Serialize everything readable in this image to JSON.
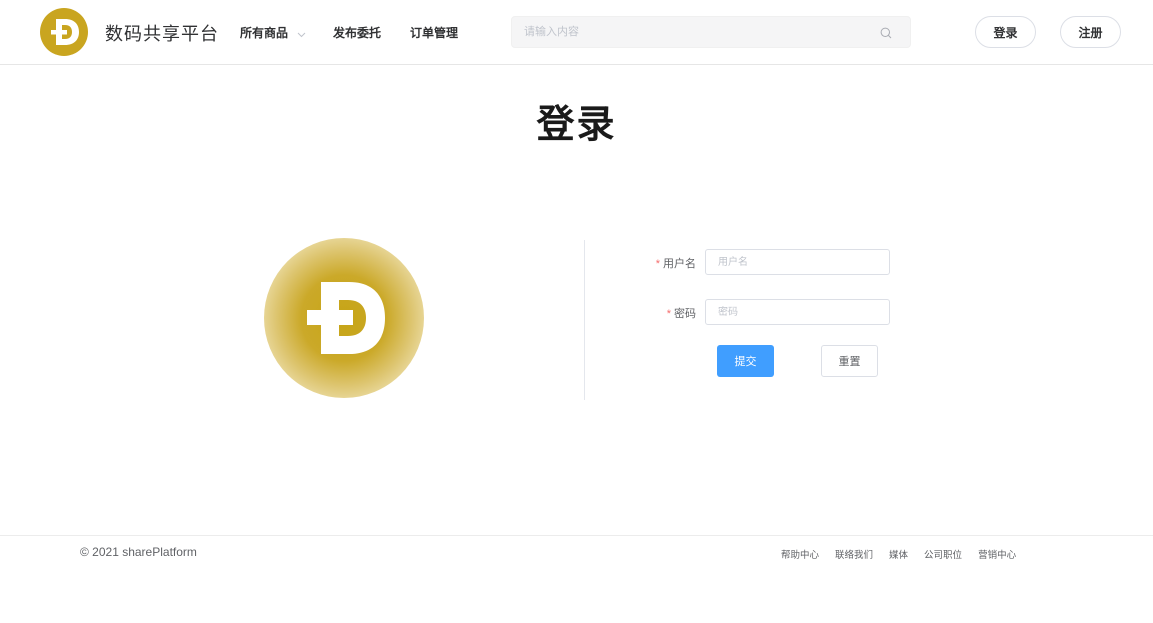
{
  "header": {
    "brand": "数码共享平台",
    "nav": {
      "all_products": "所有商品",
      "publish": "发布委托",
      "orders": "订单管理"
    },
    "search": {
      "placeholder": "请输入内容"
    },
    "login_btn": "登录",
    "register_btn": "注册"
  },
  "logo": {
    "glyph": "Đ",
    "color": "#c9a520"
  },
  "main": {
    "title": "登录",
    "form": {
      "username_label": "用户名",
      "username_placeholder": "用户名",
      "username_value": "",
      "password_label": "密码",
      "password_placeholder": "密码",
      "password_value": "",
      "required_mark": "*",
      "submit": "提交",
      "reset": "重置"
    }
  },
  "footer": {
    "copyright": "© 2021 sharePlatform",
    "links": [
      "帮助中心",
      "联络我们",
      "媒体",
      "公司职位",
      "营销中心"
    ]
  },
  "colors": {
    "accent": "#409eff",
    "logo_gold": "#c9a520",
    "required": "#f56c6c"
  }
}
